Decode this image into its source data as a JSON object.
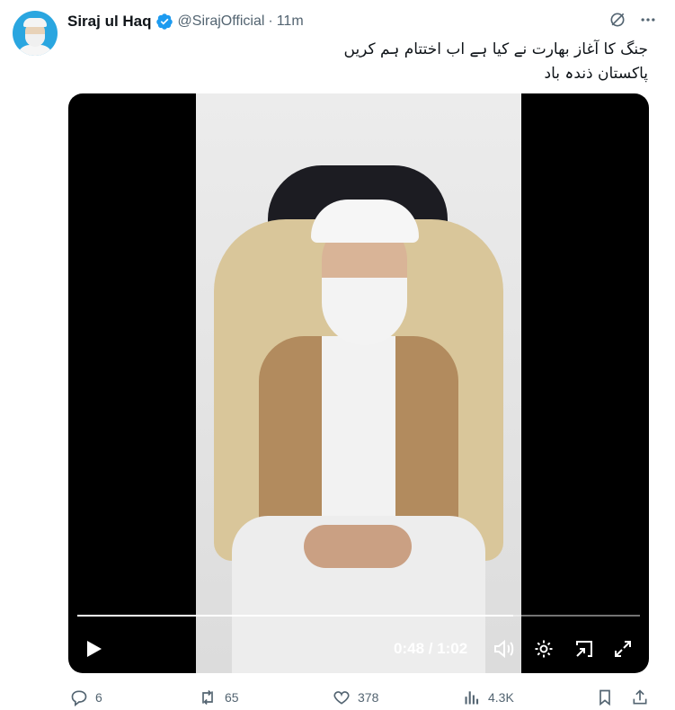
{
  "author": {
    "name": "Siraj ul Haq",
    "handle": "@SirajOfficial",
    "separator": "·",
    "time": "11m"
  },
  "icons": {
    "verified": "verified-badge-icon",
    "grok": "grok-icon",
    "more": "more-dots-icon"
  },
  "tweet": {
    "lines": [
      "جنگ کا آغاز بھارت نے کیا ہے اب اختتام ہم کریں",
      "پاکستان ذندہ باد"
    ]
  },
  "video": {
    "current_time": "0:48",
    "duration": "1:02",
    "time_display": "0:48 / 1:02",
    "progress_fraction": 0.774
  },
  "actions": {
    "replies": "6",
    "reposts": "65",
    "likes": "378",
    "views": "4.3K"
  },
  "colors": {
    "verified": "#1d9bf0",
    "muted": "#536471",
    "video_bg": "#000000",
    "text": "#0f1419"
  }
}
